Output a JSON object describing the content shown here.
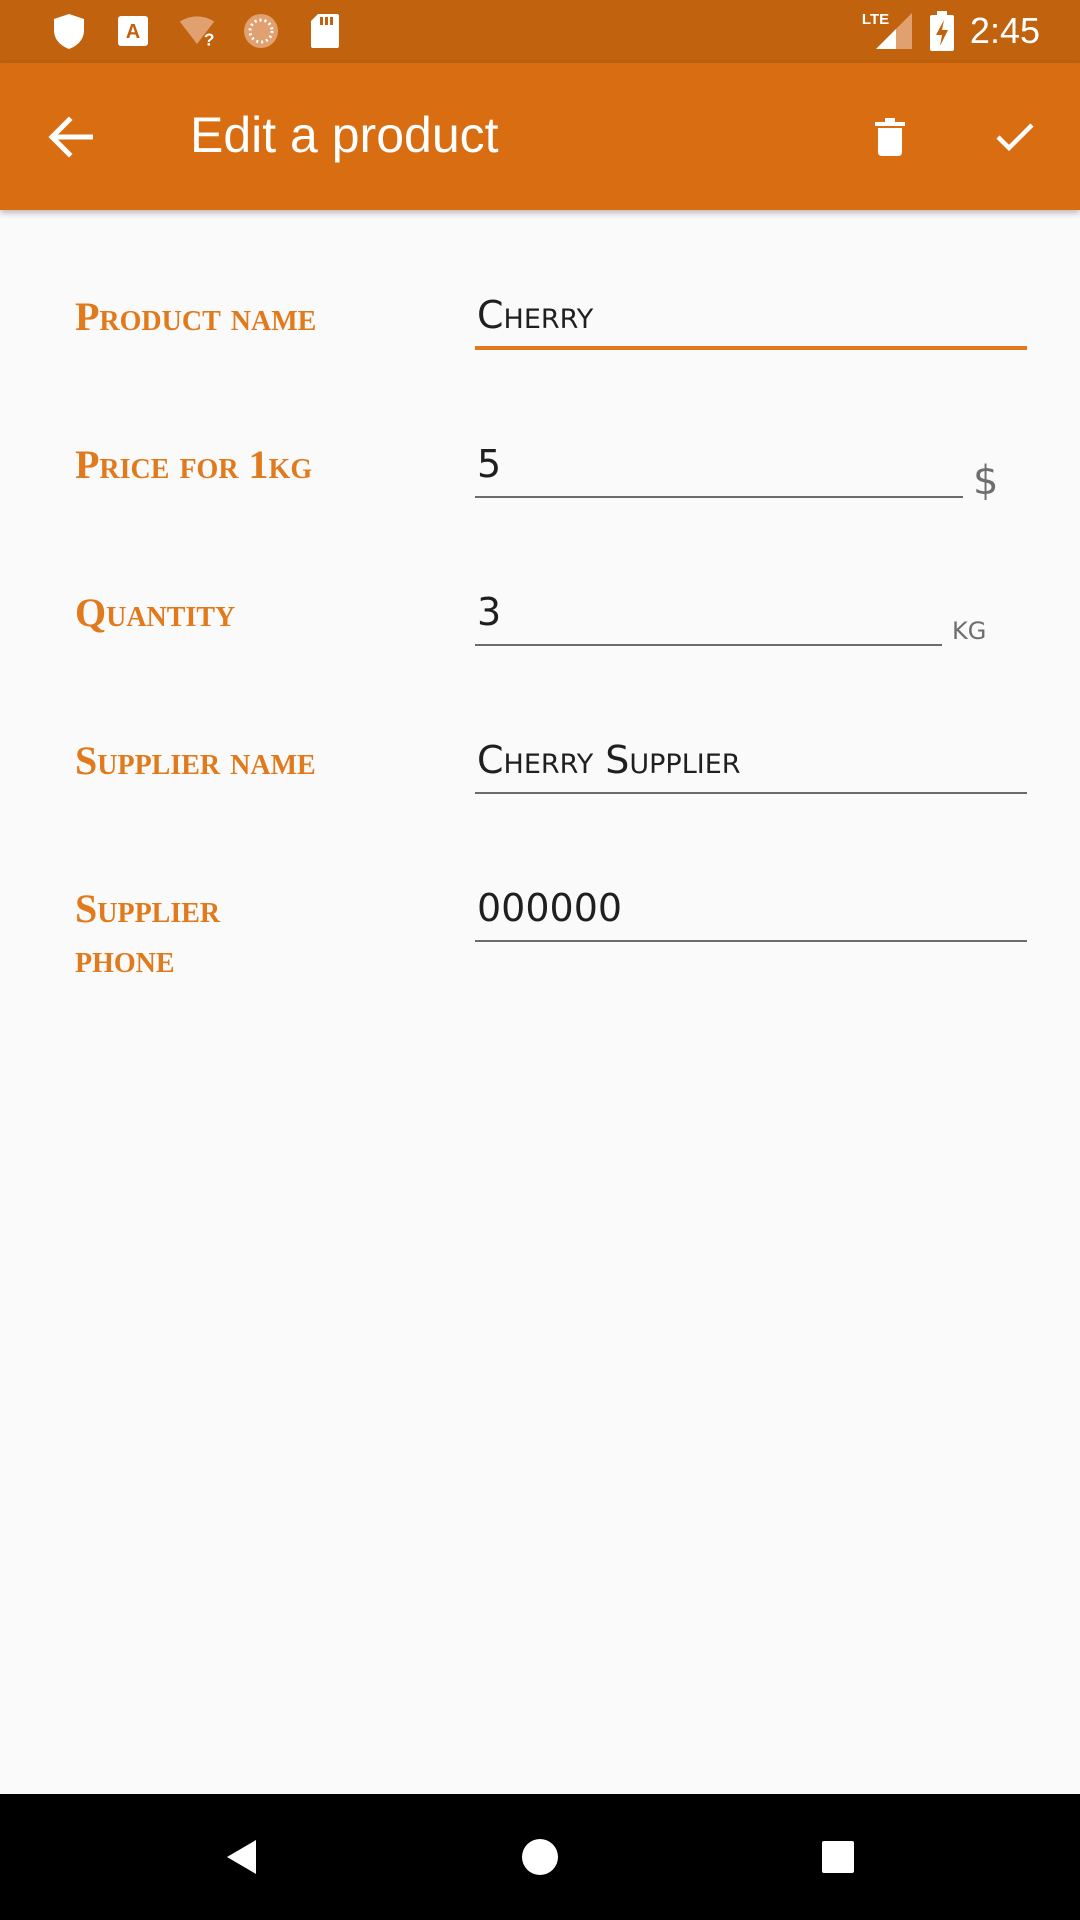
{
  "status_bar": {
    "time": "2:45",
    "network": "LTE",
    "icons_left": [
      "shield-icon",
      "text-app-icon",
      "wifi-unknown-icon",
      "loading-icon",
      "sd-card-icon"
    ],
    "icons_right": [
      "lte-signal-icon",
      "battery-charging-icon"
    ]
  },
  "toolbar": {
    "title": "Edit a product",
    "back_icon": "arrow-back-icon",
    "delete_icon": "trash-icon",
    "save_icon": "check-icon"
  },
  "form": {
    "product_name": {
      "label": "Product name",
      "value": "Cherry",
      "focused": true
    },
    "price": {
      "label": "Price for 1kg",
      "value": "5",
      "unit": "$"
    },
    "quantity": {
      "label": "Quantity",
      "value": "3",
      "unit": "kg"
    },
    "supplier_name": {
      "label": "Supplier name",
      "value": "Cherry Supplier"
    },
    "supplier_phone": {
      "label": "Supplier phone",
      "value": "000000"
    }
  },
  "colors": {
    "status_bar": "#c0620e",
    "toolbar": "#d86d11",
    "accent": "#e07a1c",
    "background": "#fafafa"
  },
  "nav_bar": {
    "buttons": [
      "back-triangle-icon",
      "home-circle-icon",
      "recents-square-icon"
    ]
  }
}
